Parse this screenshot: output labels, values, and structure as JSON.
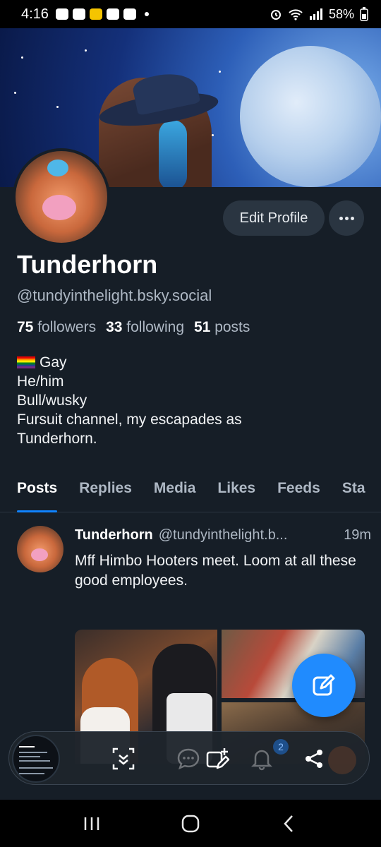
{
  "status_bar": {
    "time": "4:16",
    "battery": "58%",
    "notification_icons": [
      "chat-icon",
      "discord-icon",
      "app-icon",
      "butterfly-icon",
      "swipe-icon"
    ]
  },
  "profile": {
    "display_name": "Tunderhorn",
    "handle": "@tundyinthelight.bsky.social",
    "edit_button": "Edit Profile",
    "stats": {
      "followers_count": "75",
      "followers_label": "followers",
      "following_count": "33",
      "following_label": "following",
      "posts_count": "51",
      "posts_label": "posts"
    },
    "bio": {
      "line1": "Gay",
      "line2": "He/him",
      "line3": "Bull/wusky",
      "line4": "Fursuit channel, my escapades as Tunderhorn."
    }
  },
  "tabs": [
    {
      "label": "Posts"
    },
    {
      "label": "Replies"
    },
    {
      "label": "Media"
    },
    {
      "label": "Likes"
    },
    {
      "label": "Feeds"
    },
    {
      "label": "Sta"
    }
  ],
  "post": {
    "author": "Tunderhorn",
    "handle": "@tundyinthelight.b...",
    "time": "19m",
    "text": "Mff Himbo Hooters meet. Loom at all these good employees."
  },
  "overlay_bar": {
    "notification_count": "2"
  },
  "colors": {
    "background": "#161e27",
    "accent": "#208bfe",
    "muted_text": "#aeb8c4"
  }
}
